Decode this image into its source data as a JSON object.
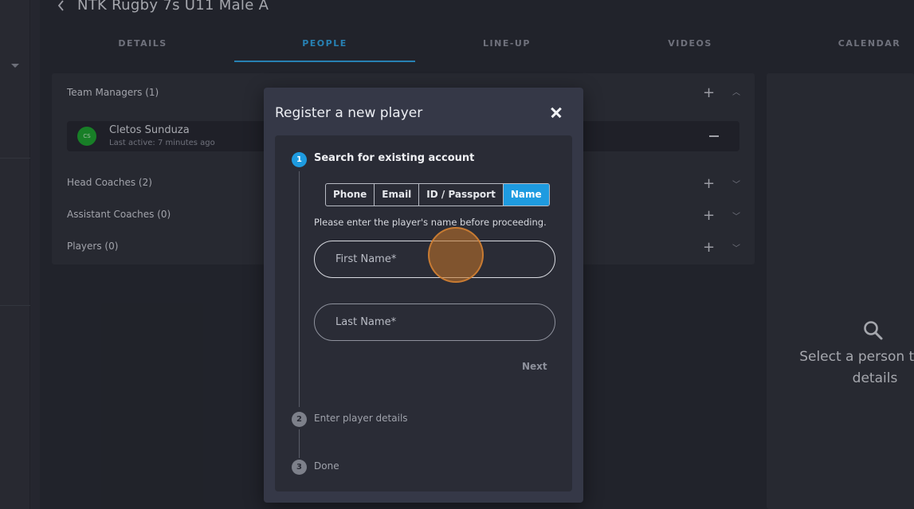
{
  "header": {
    "back_icon": "chevron-left-icon",
    "title": "NTK Rugby 7s U11 Male A"
  },
  "tabs": [
    {
      "label": "DETAILS",
      "active": false
    },
    {
      "label": "PEOPLE",
      "active": true
    },
    {
      "label": "LINE-UP",
      "active": false
    },
    {
      "label": "VIDEOS",
      "active": false
    },
    {
      "label": "CALENDAR",
      "active": false
    }
  ],
  "people": {
    "team_managers": "Team Managers (1)",
    "manager": {
      "initials": "CS",
      "name": "Cletos Sunduza",
      "last_active": "Last active: 7 minutes ago"
    },
    "head_coaches": "Head Coaches (2)",
    "assistant_coaches": "Assistant Coaches (0)",
    "players": "Players (0)"
  },
  "detail": {
    "icon": "search-icon",
    "empty_text": "Select a person to see details"
  },
  "modal": {
    "title": "Register a new player",
    "close_icon": "close-icon",
    "steps": [
      {
        "number": "1",
        "label": "Search for existing account",
        "active": true
      },
      {
        "number": "2",
        "label": "Enter player details",
        "active": false
      },
      {
        "number": "3",
        "label": "Done",
        "active": false
      }
    ],
    "search_modes": [
      "Phone",
      "Email",
      "ID / Passport",
      "Name"
    ],
    "selected_mode": "Name",
    "hint": "Please enter the player's name before proceeding.",
    "first_name_placeholder": "First Name*",
    "last_name_placeholder": "Last Name*",
    "next_label": "Next"
  },
  "colors": {
    "accent": "#1e9be0",
    "avatar": "#1aa32b",
    "touch_indicator": "#c67628"
  }
}
